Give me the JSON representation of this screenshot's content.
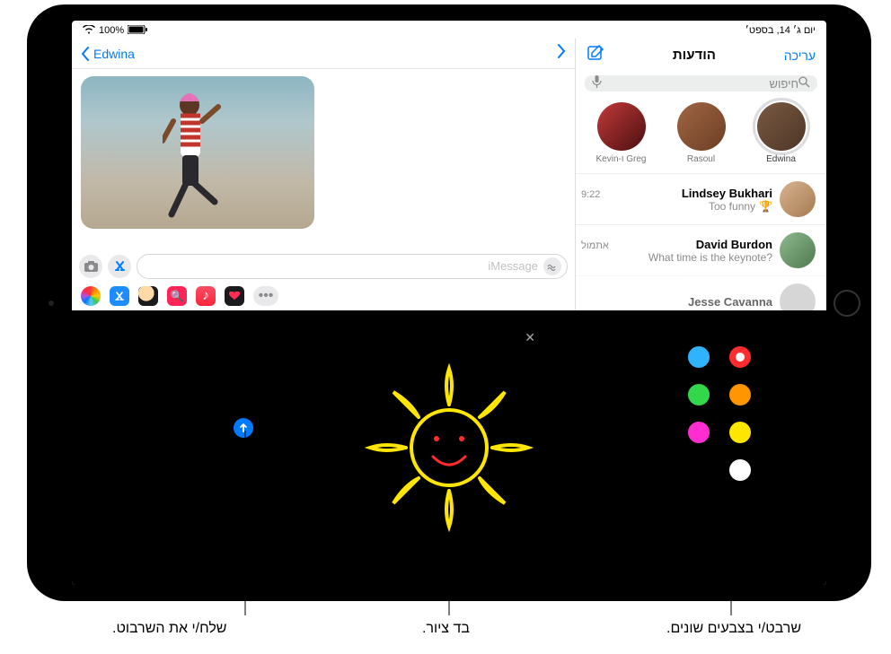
{
  "status": {
    "battery": "100%",
    "time_date": "יום ג׳ 14, בספט׳",
    "carrier_icon": "wifi-icon"
  },
  "sidebar": {
    "edit": "עריכה",
    "title": "הודעות",
    "search_placeholder": "חיפוש",
    "pinned": [
      {
        "name": "Edwina",
        "selected": true
      },
      {
        "name": "Rasoul",
        "selected": false
      },
      {
        "name": "Kevin-ו Greg",
        "selected": false
      }
    ],
    "conversations": [
      {
        "name": "Lindsey Bukhari",
        "time": "9:22",
        "preview": "Too funny",
        "badge": "🏆"
      },
      {
        "name": "David Burdon",
        "time": "אתמול",
        "preview": "What time is the keynote?",
        "badge": ""
      },
      {
        "name": "Jesse Cavanna",
        "time": "",
        "preview": "",
        "badge": ""
      }
    ]
  },
  "conversation": {
    "back_label": "Edwina",
    "input_placeholder": "iMessage"
  },
  "app_strip": {
    "icons": [
      "photos",
      "appstore",
      "memoji",
      "images",
      "music",
      "digitaltouch",
      "more"
    ]
  },
  "digital_touch": {
    "colors": [
      {
        "hex": "#2fb3ff",
        "selected": false
      },
      {
        "hex": "#ff2d2d",
        "selected": true
      },
      {
        "hex": "#32d74b",
        "selected": false
      },
      {
        "hex": "#ff9500",
        "selected": false
      },
      {
        "hex": "#ff2dd0",
        "selected": false
      },
      {
        "hex": "#ffe600",
        "selected": false
      },
      {
        "hex": "",
        "selected": false,
        "spacer": true
      },
      {
        "hex": "#ffffff",
        "selected": false
      }
    ]
  },
  "callouts": {
    "colors": "שרבט/י בצבעים שונים.",
    "canvas": "בד ציור.",
    "send": "שלח/י את השרבוט."
  }
}
